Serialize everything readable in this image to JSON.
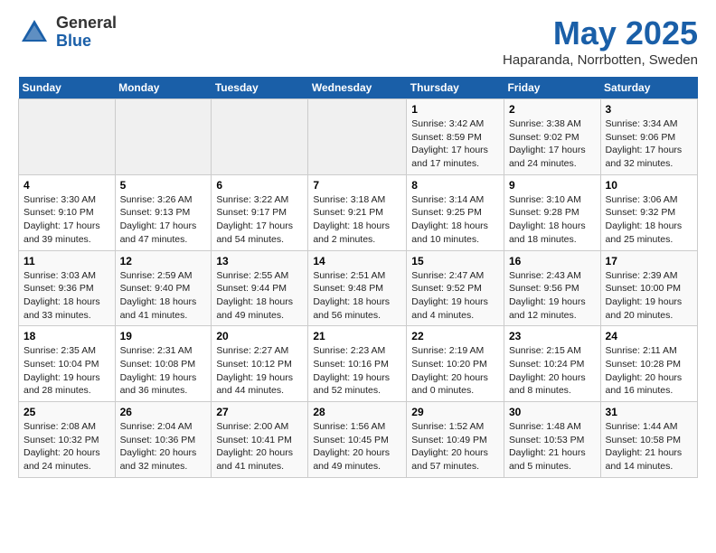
{
  "header": {
    "logo_general": "General",
    "logo_blue": "Blue",
    "month": "May 2025",
    "location": "Haparanda, Norrbotten, Sweden"
  },
  "weekdays": [
    "Sunday",
    "Monday",
    "Tuesday",
    "Wednesday",
    "Thursday",
    "Friday",
    "Saturday"
  ],
  "weeks": [
    [
      {
        "day": "",
        "info": ""
      },
      {
        "day": "",
        "info": ""
      },
      {
        "day": "",
        "info": ""
      },
      {
        "day": "",
        "info": ""
      },
      {
        "day": "1",
        "info": "Sunrise: 3:42 AM\nSunset: 8:59 PM\nDaylight: 17 hours\nand 17 minutes."
      },
      {
        "day": "2",
        "info": "Sunrise: 3:38 AM\nSunset: 9:02 PM\nDaylight: 17 hours\nand 24 minutes."
      },
      {
        "day": "3",
        "info": "Sunrise: 3:34 AM\nSunset: 9:06 PM\nDaylight: 17 hours\nand 32 minutes."
      }
    ],
    [
      {
        "day": "4",
        "info": "Sunrise: 3:30 AM\nSunset: 9:10 PM\nDaylight: 17 hours\nand 39 minutes."
      },
      {
        "day": "5",
        "info": "Sunrise: 3:26 AM\nSunset: 9:13 PM\nDaylight: 17 hours\nand 47 minutes."
      },
      {
        "day": "6",
        "info": "Sunrise: 3:22 AM\nSunset: 9:17 PM\nDaylight: 17 hours\nand 54 minutes."
      },
      {
        "day": "7",
        "info": "Sunrise: 3:18 AM\nSunset: 9:21 PM\nDaylight: 18 hours\nand 2 minutes."
      },
      {
        "day": "8",
        "info": "Sunrise: 3:14 AM\nSunset: 9:25 PM\nDaylight: 18 hours\nand 10 minutes."
      },
      {
        "day": "9",
        "info": "Sunrise: 3:10 AM\nSunset: 9:28 PM\nDaylight: 18 hours\nand 18 minutes."
      },
      {
        "day": "10",
        "info": "Sunrise: 3:06 AM\nSunset: 9:32 PM\nDaylight: 18 hours\nand 25 minutes."
      }
    ],
    [
      {
        "day": "11",
        "info": "Sunrise: 3:03 AM\nSunset: 9:36 PM\nDaylight: 18 hours\nand 33 minutes."
      },
      {
        "day": "12",
        "info": "Sunrise: 2:59 AM\nSunset: 9:40 PM\nDaylight: 18 hours\nand 41 minutes."
      },
      {
        "day": "13",
        "info": "Sunrise: 2:55 AM\nSunset: 9:44 PM\nDaylight: 18 hours\nand 49 minutes."
      },
      {
        "day": "14",
        "info": "Sunrise: 2:51 AM\nSunset: 9:48 PM\nDaylight: 18 hours\nand 56 minutes."
      },
      {
        "day": "15",
        "info": "Sunrise: 2:47 AM\nSunset: 9:52 PM\nDaylight: 19 hours\nand 4 minutes."
      },
      {
        "day": "16",
        "info": "Sunrise: 2:43 AM\nSunset: 9:56 PM\nDaylight: 19 hours\nand 12 minutes."
      },
      {
        "day": "17",
        "info": "Sunrise: 2:39 AM\nSunset: 10:00 PM\nDaylight: 19 hours\nand 20 minutes."
      }
    ],
    [
      {
        "day": "18",
        "info": "Sunrise: 2:35 AM\nSunset: 10:04 PM\nDaylight: 19 hours\nand 28 minutes."
      },
      {
        "day": "19",
        "info": "Sunrise: 2:31 AM\nSunset: 10:08 PM\nDaylight: 19 hours\nand 36 minutes."
      },
      {
        "day": "20",
        "info": "Sunrise: 2:27 AM\nSunset: 10:12 PM\nDaylight: 19 hours\nand 44 minutes."
      },
      {
        "day": "21",
        "info": "Sunrise: 2:23 AM\nSunset: 10:16 PM\nDaylight: 19 hours\nand 52 minutes."
      },
      {
        "day": "22",
        "info": "Sunrise: 2:19 AM\nSunset: 10:20 PM\nDaylight: 20 hours\nand 0 minutes."
      },
      {
        "day": "23",
        "info": "Sunrise: 2:15 AM\nSunset: 10:24 PM\nDaylight: 20 hours\nand 8 minutes."
      },
      {
        "day": "24",
        "info": "Sunrise: 2:11 AM\nSunset: 10:28 PM\nDaylight: 20 hours\nand 16 minutes."
      }
    ],
    [
      {
        "day": "25",
        "info": "Sunrise: 2:08 AM\nSunset: 10:32 PM\nDaylight: 20 hours\nand 24 minutes."
      },
      {
        "day": "26",
        "info": "Sunrise: 2:04 AM\nSunset: 10:36 PM\nDaylight: 20 hours\nand 32 minutes."
      },
      {
        "day": "27",
        "info": "Sunrise: 2:00 AM\nSunset: 10:41 PM\nDaylight: 20 hours\nand 41 minutes."
      },
      {
        "day": "28",
        "info": "Sunrise: 1:56 AM\nSunset: 10:45 PM\nDaylight: 20 hours\nand 49 minutes."
      },
      {
        "day": "29",
        "info": "Sunrise: 1:52 AM\nSunset: 10:49 PM\nDaylight: 20 hours\nand 57 minutes."
      },
      {
        "day": "30",
        "info": "Sunrise: 1:48 AM\nSunset: 10:53 PM\nDaylight: 21 hours\nand 5 minutes."
      },
      {
        "day": "31",
        "info": "Sunrise: 1:44 AM\nSunset: 10:58 PM\nDaylight: 21 hours\nand 14 minutes."
      }
    ]
  ]
}
